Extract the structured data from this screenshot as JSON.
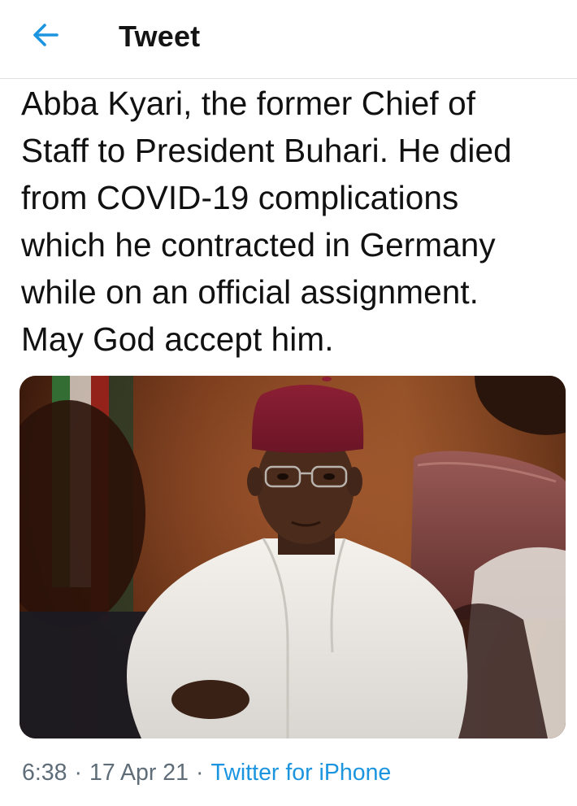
{
  "header": {
    "back_icon": "arrow-left-icon",
    "title": "Tweet"
  },
  "tweet": {
    "text": "Abba Kyari, the former Chief of\nStaff to President Buhari. He died\nfrom COVID-19 complications\nwhich he contracted in Germany\nwhile on an official assignment.\nMay God accept him.",
    "time": "6:38",
    "date": "17 Apr 21",
    "source": "Twitter for iPhone",
    "separator": "·"
  },
  "colors": {
    "accent": "#1b95e0",
    "meta_text": "#5f6d78",
    "divider": "#dfe3e6"
  }
}
